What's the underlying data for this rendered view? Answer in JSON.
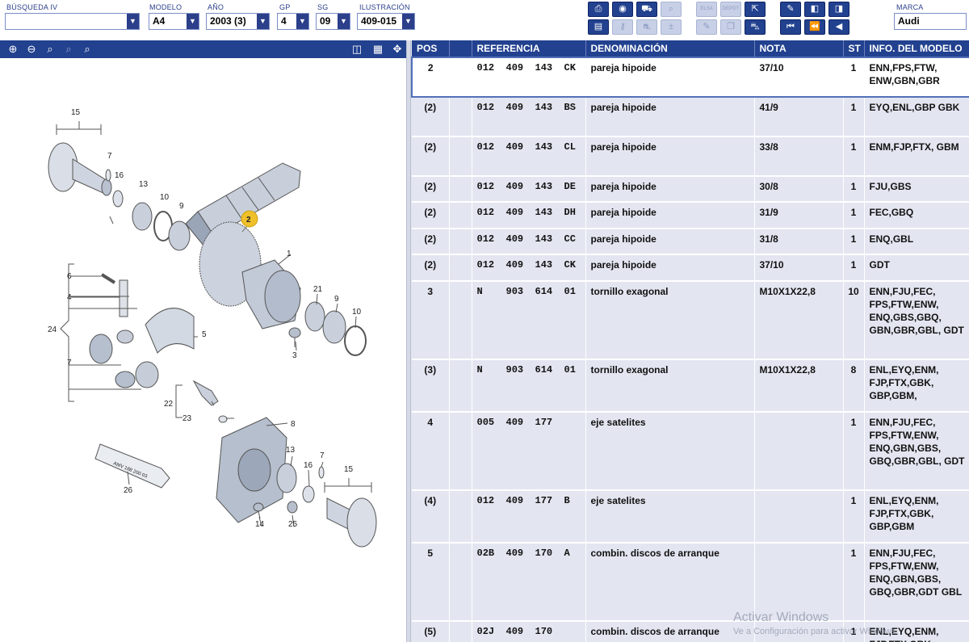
{
  "filters": {
    "busqueda": {
      "label": "BÚSQUEDA IV",
      "value": ""
    },
    "modelo": {
      "label": "MODELO",
      "value": "A4"
    },
    "anio": {
      "label": "AÑO",
      "value": "2003 (3)"
    },
    "gp": {
      "label": "GP",
      "value": "4"
    },
    "sg": {
      "label": "SG",
      "value": "09"
    },
    "ilustracion": {
      "label": "ILUSTRACIÓN",
      "value": "409-015"
    },
    "marca": {
      "label": "MARCA",
      "value": "Audi"
    },
    "dropdown_glyph": "▼"
  },
  "toolbar": {
    "icons": [
      "print-icon",
      "parts-info-icon",
      "vehicle-icon",
      "zoom-car-icon",
      "elsa-icon",
      "depot-icon",
      "cart-export-icon",
      "pin-icon",
      "prev-page-icon",
      "next-page-icon",
      "list-icon",
      "key-icon",
      "car-outline-icon",
      "add-remove-icon",
      "edit-icon",
      "copy-icon",
      "cart-icon",
      "first-icon",
      "previous-icon",
      "back-icon"
    ],
    "elsa_label": "ELSA",
    "depot_label": "DEPOT"
  },
  "viewer": {
    "icons": [
      "zoom-in-icon",
      "zoom-out-icon",
      "zoom-fit-icon",
      "zoom-area-icon",
      "zoom-reset-icon",
      "split-view-icon",
      "table-view-icon",
      "fullscreen-arrows-icon"
    ],
    "callouts": [
      "15",
      "7",
      "16",
      "13",
      "10",
      "9",
      "2",
      "1",
      "6",
      "4",
      "24",
      "7",
      "5",
      "21",
      "9",
      "10",
      "3",
      "22",
      "23",
      "8",
      "13",
      "7",
      "16",
      "15",
      "26",
      "14",
      "25"
    ],
    "tube_text": "AMV 188 200 03"
  },
  "table": {
    "headers": {
      "pos": "POS",
      "referencia": "REFERENCIA",
      "denominacion": "DENOMINACIÓN",
      "nota": "NOTA",
      "st": "ST",
      "info": "INFO. DEL MODELO"
    },
    "rows": [
      {
        "pos": "2",
        "ref": "012  409  143  CK",
        "den": "pareja hipoide",
        "nota": "37/10",
        "st": "1",
        "info": "ENN,FPS,FTW, ENW,GBN,GBR"
      },
      {
        "pos": "(2)",
        "ref": "012  409  143  BS",
        "den": "pareja hipoide",
        "nota": "41/9",
        "st": "1",
        "info": "EYQ,ENL,GBP GBK"
      },
      {
        "pos": "(2)",
        "ref": "012  409  143  CL",
        "den": "pareja hipoide",
        "nota": "33/8",
        "st": "1",
        "info": "ENM,FJP,FTX, GBM"
      },
      {
        "pos": "(2)",
        "ref": "012  409  143  DE",
        "den": "pareja hipoide",
        "nota": "30/8",
        "st": "1",
        "info": "FJU,GBS"
      },
      {
        "pos": "(2)",
        "ref": "012  409  143  DH",
        "den": "pareja hipoide",
        "nota": "31/9",
        "st": "1",
        "info": "FEC,GBQ"
      },
      {
        "pos": "(2)",
        "ref": "012  409  143  CC",
        "den": "pareja hipoide",
        "nota": "31/8",
        "st": "1",
        "info": "ENQ,GBL"
      },
      {
        "pos": "(2)",
        "ref": "012  409  143  CK",
        "den": "pareja hipoide",
        "nota": "37/10",
        "st": "1",
        "info": "GDT"
      },
      {
        "pos": "3",
        "ref": "N    903  614  01",
        "den": "tornillo exagonal",
        "nota": "M10X1X22,8",
        "st": "10",
        "info": "ENN,FJU,FEC, FPS,FTW,ENW, ENQ,GBS,GBQ, GBN,GBR,GBL, GDT"
      },
      {
        "pos": "(3)",
        "ref": "N    903  614  01",
        "den": "tornillo exagonal",
        "nota": "M10X1X22,8",
        "st": "8",
        "info": "ENL,EYQ,ENM, FJP,FTX,GBK, GBP,GBM,"
      },
      {
        "pos": "4",
        "ref": "005  409  177",
        "den": "eje satelites",
        "nota": "",
        "st": "1",
        "info": "ENN,FJU,FEC, FPS,FTW,ENW, ENQ,GBN,GBS, GBQ,GBR,GBL, GDT"
      },
      {
        "pos": "(4)",
        "ref": "012  409  177  B",
        "den": "eje satelites",
        "nota": "",
        "st": "1",
        "info": "ENL,EYQ,ENM, FJP,FTX,GBK, GBP,GBM"
      },
      {
        "pos": "5",
        "ref": "02B  409  170  A",
        "den": "combin. discos de arranque",
        "nota": "",
        "st": "1",
        "info": "ENN,FJU,FEC, FPS,FTW,ENW, ENQ,GBN,GBS, GBQ,GBR,GDT GBL"
      },
      {
        "pos": "(5)",
        "ref": "02J  409  170",
        "den": "combin. discos de arranque",
        "nota": "",
        "st": "1",
        "info": "ENL,EYQ,ENM, FJP,FTX,GBK"
      }
    ]
  },
  "watermark": {
    "line1": "Activar Windows",
    "line2": "Ve a Configuración para activar Windows."
  }
}
